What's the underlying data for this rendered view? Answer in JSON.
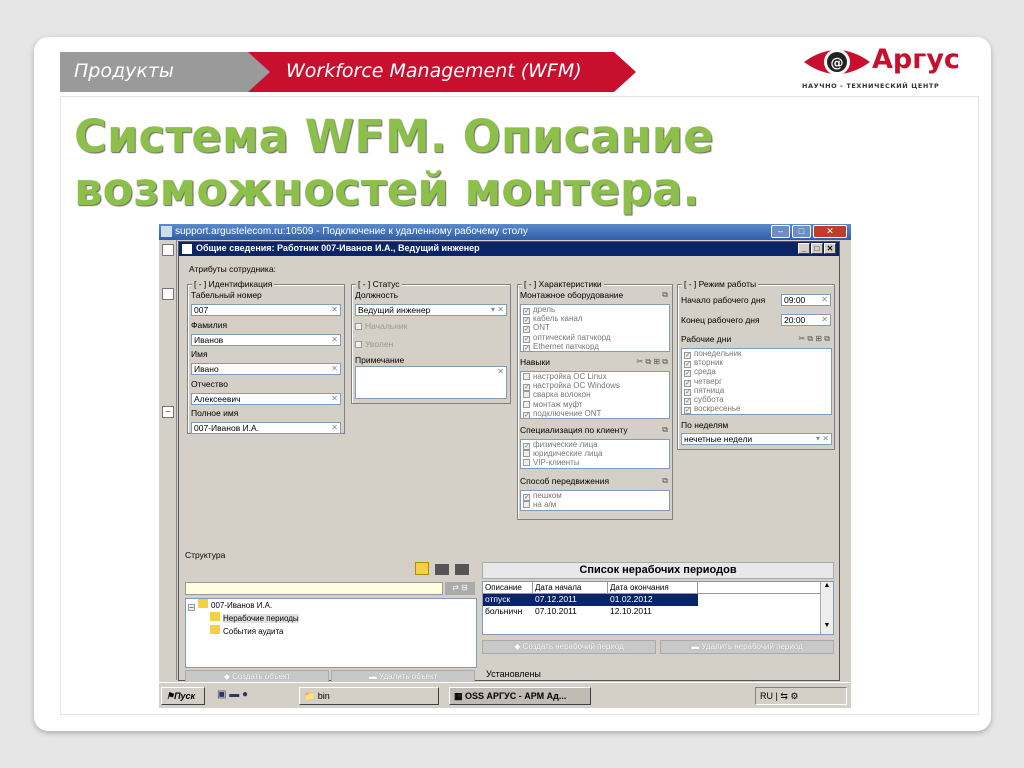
{
  "header": {
    "crumb_section": "Продукты",
    "crumb_page": "Workforce Management (WFM)"
  },
  "logo": {
    "name": "Аргус",
    "subtitle": "НАУЧНО - ТЕХНИЧЕСКИЙ ЦЕНТР",
    "brand_color": "#c8102e"
  },
  "slide": {
    "title_line1": "Система WFM. Описание",
    "title_line2": "возможностей монтера.",
    "title_color": "#8cc04b"
  },
  "remote": {
    "title": "support.argustelecom.ru:10509 - Подключение к удаленному рабочему столу"
  },
  "window": {
    "title": "Общие сведения: Работник 007-Иванов И.А., Ведущий инженер",
    "attributes_label": "Атрибуты сотрудника:"
  },
  "identification": {
    "group": "[ - ] Идентификация",
    "tab_label": "Табельный номер",
    "tab_value": "007",
    "lastname_label": "Фамилия",
    "lastname_value": "Иванов",
    "name_label": "Имя",
    "name_value": "Ивано",
    "patronymic_label": "Отчество",
    "patronymic_value": "Алексеевич",
    "fullname_label": "Полное имя",
    "fullname_value": "007-Иванов И.А."
  },
  "status": {
    "group": "[ - ] Статус",
    "position_label": "Должность",
    "position_value": "Ведущий инженер",
    "chief": "Начальник",
    "fired": "Уволен",
    "note_label": "Примечание"
  },
  "characteristics": {
    "group": "[ - ] Характеристики",
    "equipment_label": "Монтажное оборудование",
    "equipment": [
      "дрель",
      "кабель канал",
      "ONT",
      "оптический патчкорд",
      "Ethernet патчкорд"
    ],
    "skills_label": "Навыки",
    "skills": [
      "настройка ОС Linux",
      "настройка ОС Windows",
      "сварка волокон",
      "монтаж муфт",
      "подключение ONT"
    ],
    "skills_checked": [
      false,
      true,
      false,
      false,
      true
    ],
    "spec_label": "Специализация по клиенту",
    "spec": [
      "физические лица",
      "юридические лица",
      "VIP-клиенты"
    ],
    "spec_checked": [
      true,
      false,
      false
    ],
    "move_label": "Способ передвижения",
    "move": [
      "пешком",
      "на а/м"
    ],
    "move_checked": [
      true,
      false
    ]
  },
  "schedule": {
    "group": "[ - ] Режим работы",
    "start_label": "Начало рабочего дня",
    "start_value": "09:00",
    "end_label": "Конец рабочего дня",
    "end_value": "20:00",
    "days_label": "Рабочие дни",
    "days": [
      "понедельник",
      "вторник",
      "среда",
      "четверг",
      "пятница",
      "суббота",
      "воскресенье"
    ],
    "weeks_label": "По неделям",
    "weeks_value": "нечетные недели"
  },
  "structure": {
    "label": "Структура",
    "tree_root": "007-Иванов И.А.",
    "tree_child1": "Нерабочие периоды",
    "tree_child2": "События аудита",
    "create_btn": "Создать объект",
    "delete_btn": "Удалить объект"
  },
  "periods": {
    "title": "Список нерабочих периодов",
    "columns": [
      "Описание",
      "Дата начала",
      "Дата окончания"
    ],
    "rows": [
      [
        "отпуск",
        "07.12.2011",
        "01.02.2012"
      ],
      [
        "больничн",
        "07.10.2011",
        "12.10.2011"
      ]
    ],
    "create_btn": "Создать нерабочий период",
    "delete_btn": "Удалить нерабочий период",
    "bottom_label": "Установлены"
  },
  "taskbar": {
    "start": "Пуск",
    "folder": "bin",
    "app": "OSS АРГУС - АРМ Ад...",
    "lang": "RU"
  }
}
